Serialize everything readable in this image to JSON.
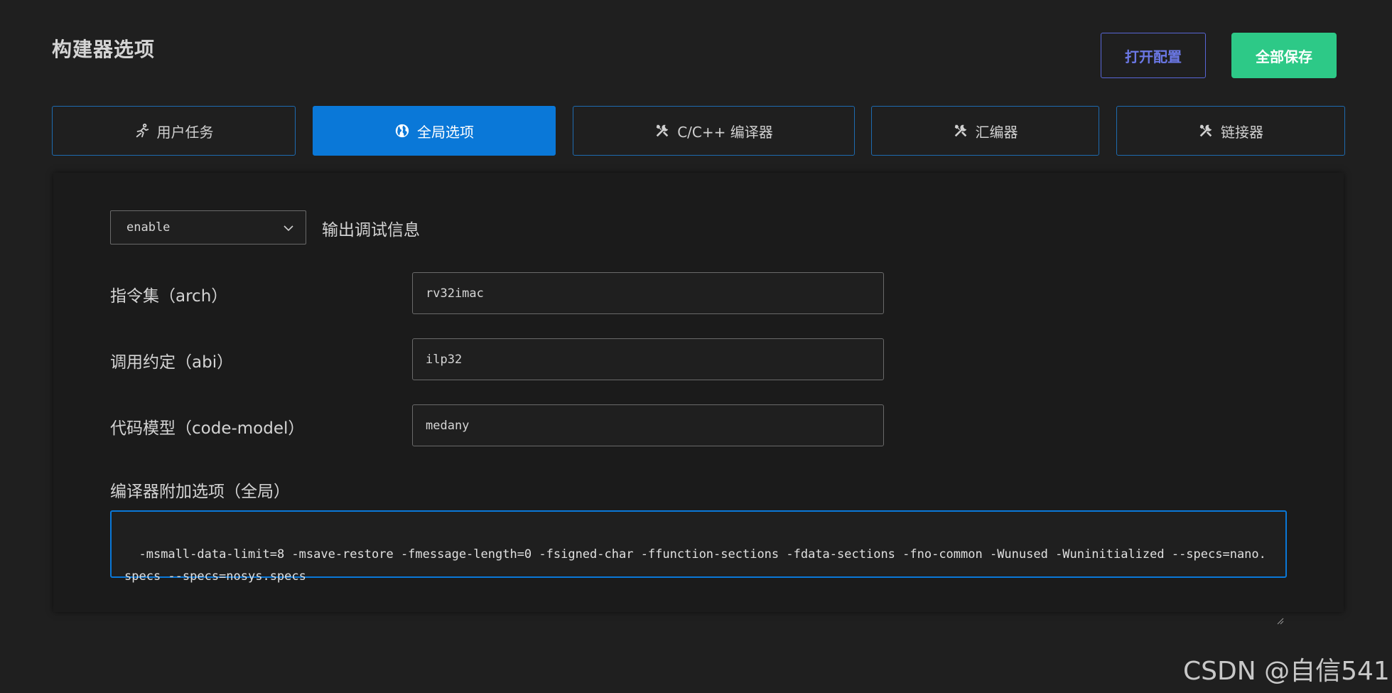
{
  "header": {
    "title": "构建器选项",
    "open_config_label": "打开配置",
    "save_all_label": "全部保存"
  },
  "tabs": [
    {
      "label": "用户任务",
      "icon": "run-icon"
    },
    {
      "label": "全局选项",
      "icon": "globe-icon",
      "active": true
    },
    {
      "label": "C/C++ 编译器",
      "icon": "tools-icon"
    },
    {
      "label": "汇编器",
      "icon": "tools-icon"
    },
    {
      "label": "链接器",
      "icon": "tools-icon"
    }
  ],
  "options": {
    "debug_select_value": "enable",
    "debug_label": "输出调试信息",
    "arch_label": "指令集（arch）",
    "arch_value": "rv32imac",
    "abi_label": "调用约定（abi）",
    "abi_value": "ilp32",
    "code_model_label": "代码模型（code-model）",
    "code_model_value": "medany",
    "extra_label": "编译器附加选项（全局）",
    "extra_value": "-msmall-data-limit=8 -msave-restore -fmessage-length=0 -fsigned-char -ffunction-sections -fdata-sections -fno-common -Wunused -Wuninitialized --specs=nano.specs --specs=nosys.specs"
  },
  "watermark": "CSDN @自信541",
  "colors": {
    "background": "#1f1f1f",
    "accent": "#0a78d8",
    "save_button": "#2dc987",
    "open_button_border": "#5866d6"
  }
}
